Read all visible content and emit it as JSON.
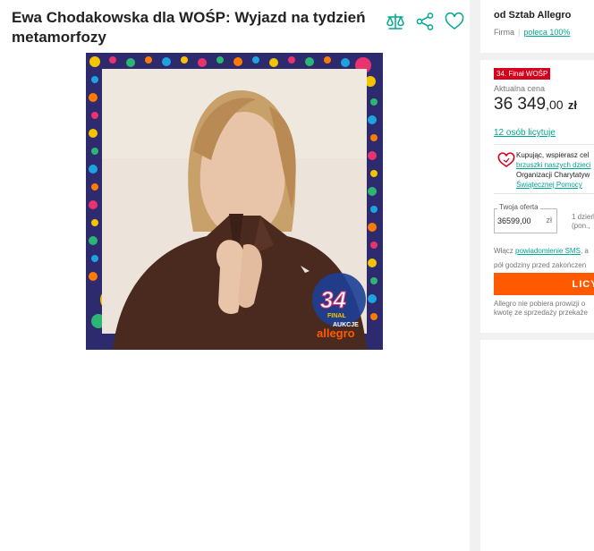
{
  "listing": {
    "title": "Ewa Chodakowska dla WOŚP: Wyjazd na tydzień metamorfozy",
    "image": {
      "badge_number": "34",
      "badge_word_finał": "FINAŁ",
      "badge_word_aukcje": "AUKCJE",
      "brand": "allegro"
    }
  },
  "actions": {
    "compare_icon": "compare-scales-icon",
    "share_icon": "share-icon",
    "favorite_icon": "heart-outline-icon"
  },
  "seller": {
    "name": "od Sztab Allegro",
    "type": "Firma",
    "recommend": "poleca 100%"
  },
  "offer": {
    "badge": "34. Finał WOŚP",
    "price_label": "Aktualna cena",
    "price_main": "36 349",
    "price_grosze": ",00",
    "currency": "zł",
    "bidders": "12 osób licytuje",
    "support_line1": "Kupując, wspierasz cel",
    "support_link1": "brzuszki naszych dzieci",
    "support_line3": "Organizacji Charytatyw",
    "support_link2": "Świątecznej Pomocy",
    "bid_label": "Twoja oferta",
    "bid_value": "36599,00",
    "bid_currency": "zł",
    "duration_line1": "1 dzień",
    "duration_line2": "(pon.,",
    "notify_prefix": "Włącz ",
    "notify_link": "powiadomienie SMS",
    "notify_suffix": ", a",
    "notify_line2": "pół godziny przed zakończen",
    "button_label": "LICY",
    "fee_line1": "Allegro nie pobiera prowizji o",
    "fee_line2": "kwotę ze sprzedaży przekaże"
  },
  "colors": {
    "accent": "#00a790",
    "badge_red": "#d6001c",
    "button_orange": "#ff5a00",
    "page_grey": "#f1f1f1"
  }
}
